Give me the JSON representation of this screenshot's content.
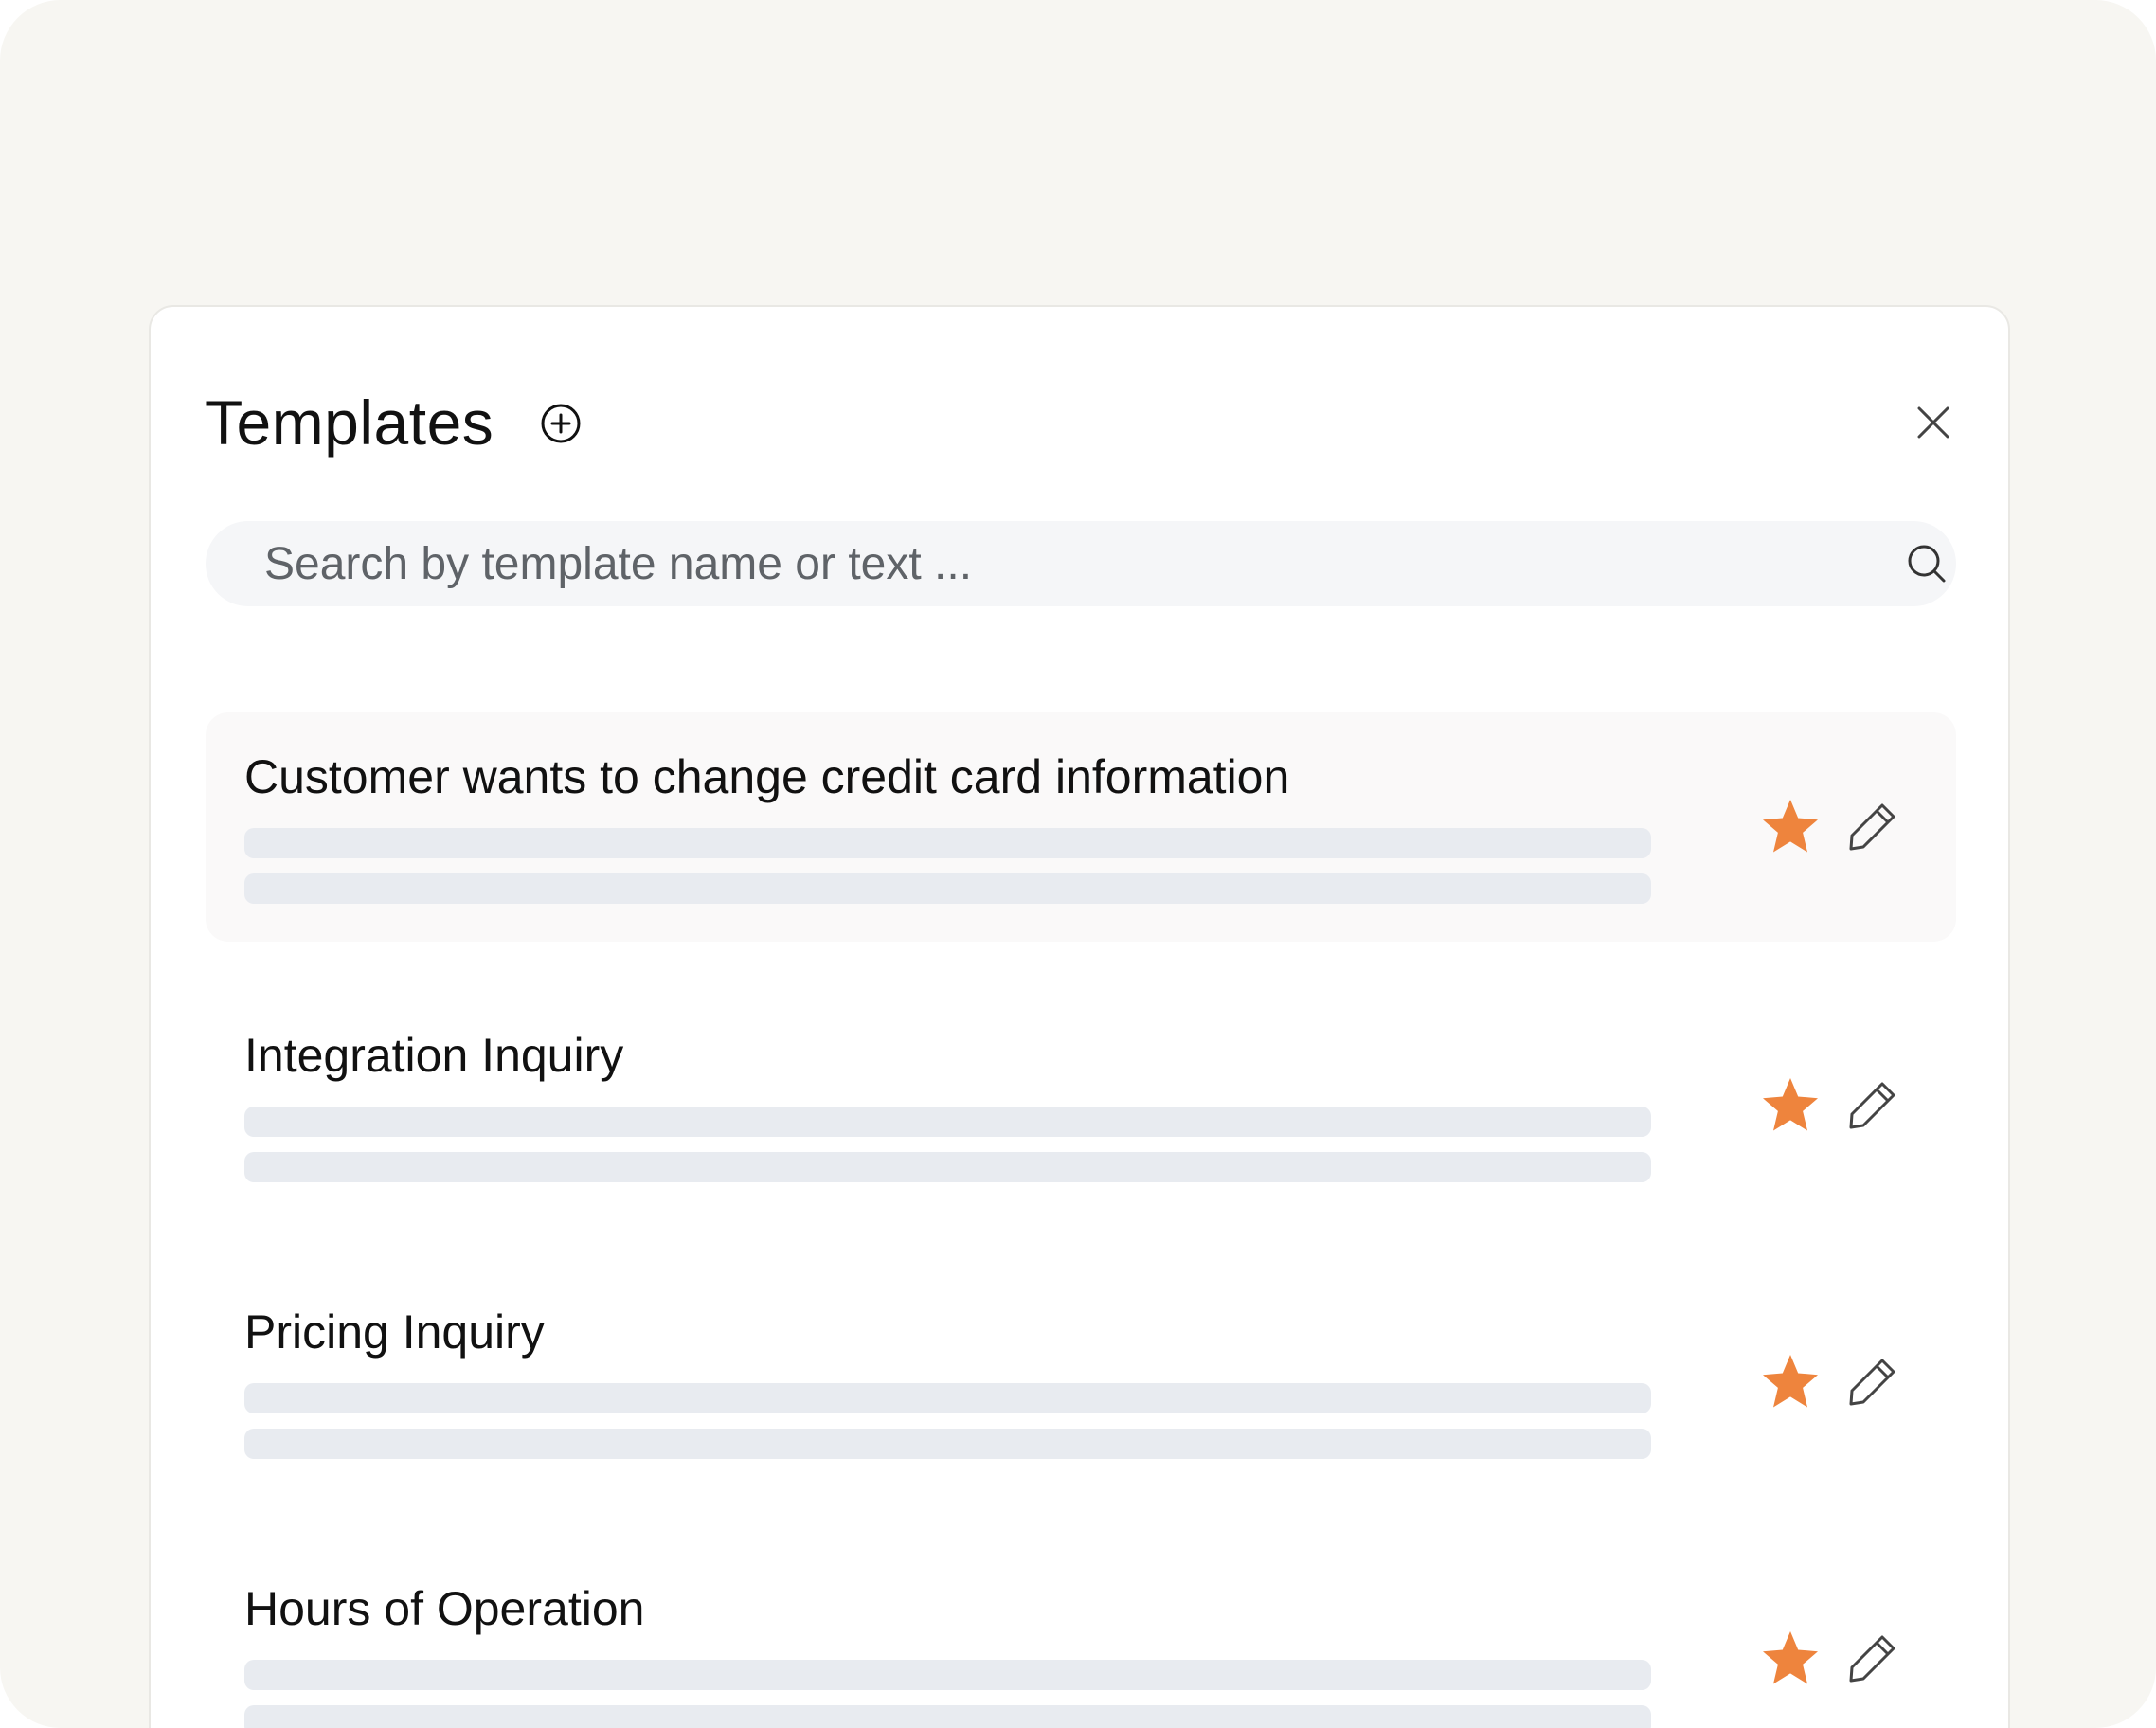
{
  "header": {
    "title": "Templates"
  },
  "search": {
    "placeholder": "Search by template name or text ..."
  },
  "colors": {
    "accent_star": "#ee843d",
    "background": "#f7f6f2",
    "skeleton": "#e8ebf0"
  },
  "templates": [
    {
      "title": "Customer wants to change credit card information",
      "favorite": true,
      "highlighted": true
    },
    {
      "title": "Integration Inquiry",
      "favorite": true,
      "highlighted": false
    },
    {
      "title": "Pricing Inquiry",
      "favorite": true,
      "highlighted": false
    },
    {
      "title": "Hours of Operation",
      "favorite": true,
      "highlighted": false
    }
  ],
  "icons": {
    "add": "plus-circle-icon",
    "close": "close-icon",
    "search": "search-icon",
    "favorite": "star-icon",
    "edit": "pencil-icon"
  }
}
